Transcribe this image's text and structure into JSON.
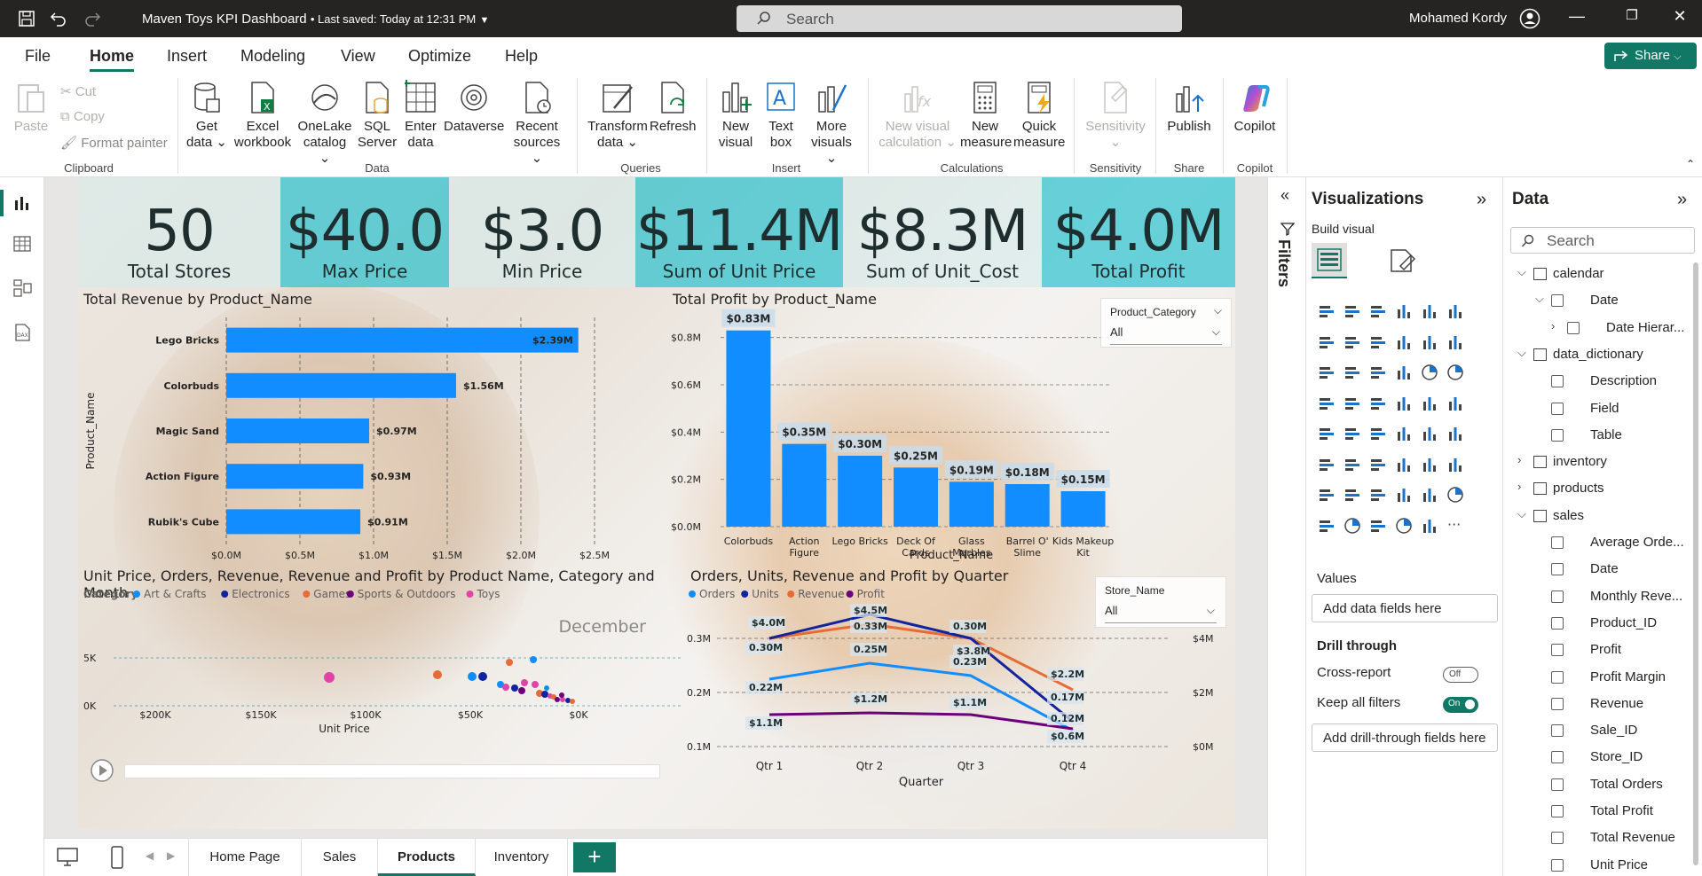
{
  "titlebar": {
    "title": "Maven Toys KPI Dashboard",
    "saved": "• Last saved: Today at 12:31 PM",
    "search_placeholder": "Search",
    "user": "Mohamed Kordy"
  },
  "menu": [
    "File",
    "Home",
    "Insert",
    "Modeling",
    "View",
    "Optimize",
    "Help"
  ],
  "share_label": "Share",
  "ribbon": {
    "clipboard": {
      "paste": "Paste",
      "cut": "Cut",
      "copy": "Copy",
      "format_painter": "Format painter",
      "group": "Clipboard"
    },
    "data": [
      {
        "l1": "Get",
        "l2": "data ⌄"
      },
      {
        "l1": "Excel",
        "l2": "workbook"
      },
      {
        "l1": "OneLake",
        "l2": "catalog ⌄"
      },
      {
        "l1": "SQL",
        "l2": "Server"
      },
      {
        "l1": "Enter",
        "l2": "data"
      },
      {
        "l1": "Dataverse",
        "l2": ""
      },
      {
        "l1": "Recent",
        "l2": "sources ⌄"
      }
    ],
    "data_group": "Data",
    "queries": [
      {
        "l1": "Transform",
        "l2": "data ⌄"
      },
      {
        "l1": "Refresh",
        "l2": ""
      }
    ],
    "queries_group": "Queries",
    "insert": [
      {
        "l1": "New",
        "l2": "visual"
      },
      {
        "l1": "Text",
        "l2": "box"
      },
      {
        "l1": "More",
        "l2": "visuals ⌄"
      }
    ],
    "insert_group": "Insert",
    "calculations": [
      {
        "l1": "New visual",
        "l2": "calculation ⌄"
      },
      {
        "l1": "New",
        "l2": "measure"
      },
      {
        "l1": "Quick",
        "l2": "measure"
      }
    ],
    "calculations_group": "Calculations",
    "sensitivity": {
      "l1": "Sensitivity",
      "l2": "⌄",
      "group": "Sensitivity"
    },
    "share": {
      "l1": "Publish",
      "group": "Share"
    },
    "copilot": {
      "l1": "Copilot",
      "group": "Copilot"
    }
  },
  "kpis": [
    {
      "value": "50",
      "label": "Total Stores"
    },
    {
      "value": "$40.0",
      "label": "Max Price"
    },
    {
      "value": "$3.0",
      "label": "Min Price"
    },
    {
      "value": "$11.4M",
      "label": "Sum of Unit Price"
    },
    {
      "value": "$8.3M",
      "label": "Sum of Unit_Cost"
    },
    {
      "value": "$4.0M",
      "label": "Total Profit"
    }
  ],
  "revenue_chart": {
    "title": "Total Revenue by Product_Name",
    "ylabel": "Product_Name",
    "categories": [
      "Lego Bricks",
      "Colorbuds",
      "Magic Sand",
      "Action Figure",
      "Rubik's Cube"
    ],
    "values": [
      2.39,
      1.56,
      0.97,
      0.93,
      0.91
    ],
    "labels": [
      "$2.39M",
      "$1.56M",
      "$0.97M",
      "$0.93M",
      "$0.91M"
    ],
    "xticks": [
      "$0.0M",
      "$0.5M",
      "$1.0M",
      "$1.5M",
      "$2.0M",
      "$2.5M"
    ],
    "xmax": 2.5
  },
  "profit_chart": {
    "title": "Total Profit by Product_Name",
    "xlabel": "Product_Name",
    "categories": [
      [
        "Colorbuds"
      ],
      [
        "Action",
        "Figure"
      ],
      [
        "Lego Bricks"
      ],
      [
        "Deck Of",
        "Cards"
      ],
      [
        "Glass",
        "Marbles"
      ],
      [
        "Barrel O'",
        "Slime"
      ],
      [
        "Kids Makeup",
        "Kit"
      ]
    ],
    "values": [
      0.83,
      0.35,
      0.3,
      0.25,
      0.19,
      0.18,
      0.15
    ],
    "labels": [
      "$0.83M",
      "$0.35M",
      "$0.30M",
      "$0.25M",
      "$0.19M",
      "$0.18M",
      "$0.15M"
    ],
    "yticks": [
      "$0.0M",
      "$0.2M",
      "$0.4M",
      "$0.6M",
      "$0.8M"
    ],
    "ymax": 0.9,
    "slicer": {
      "header": "Product_Category",
      "value": "All"
    }
  },
  "scatter_chart": {
    "title": "Unit Price, Orders, Revenue, Revenue and Profit by Product Name, Category and Month",
    "legend_title": "Category",
    "legend": [
      {
        "name": "Art & Crafts",
        "color": "#118dff"
      },
      {
        "name": "Electronics",
        "color": "#12239e"
      },
      {
        "name": "Games",
        "color": "#e66c37"
      },
      {
        "name": "Sports & Outdoors",
        "color": "#6b007b"
      },
      {
        "name": "Toys",
        "color": "#e044a7"
      }
    ],
    "play_label": "December",
    "xlabel": "Unit Price",
    "xticks": [
      "$200K",
      "$150K",
      "$100K",
      "$50K",
      "$0K"
    ],
    "yticks": [
      "0K",
      "5K"
    ]
  },
  "quarter_chart": {
    "title": "Orders, Units, Revenue and Profit by Quarter",
    "legend": [
      {
        "name": "Orders",
        "color": "#118dff"
      },
      {
        "name": "Units",
        "color": "#12239e"
      },
      {
        "name": "Revenue",
        "color": "#e66c37"
      },
      {
        "name": "Profit",
        "color": "#6b007b"
      }
    ],
    "xlabel": "Quarter",
    "categories": [
      "Qtr 1",
      "Qtr 2",
      "Qtr 3",
      "Qtr 4"
    ],
    "left_ticks": [
      "0.1M",
      "0.2M",
      "0.3M"
    ],
    "right_ticks": [
      "$0M",
      "$2M",
      "$4M"
    ],
    "labels": {
      "revenue": [
        "$4.0M",
        "$4.5M",
        "$3.8M",
        "$2.2M"
      ],
      "units": [
        "0.30M",
        "0.33M",
        "0.30M",
        "0.17M"
      ],
      "orders": [
        "0.22M",
        "0.25M",
        "0.23M",
        "0.12M"
      ],
      "profit": [
        "$1.1M",
        "$1.2M",
        "$1.1M",
        "$0.6M"
      ]
    },
    "slicer": {
      "header": "Store_Name",
      "value": "All"
    }
  },
  "tabs": [
    "Home Page",
    "Sales",
    "Products",
    "Inventory"
  ],
  "filters_label": "Filters",
  "viz_pane": {
    "title": "Visualizations",
    "build_visual": "Build visual",
    "values_label": "Values",
    "values_well": "Add data fields here",
    "drill_through": "Drill through",
    "cross_report": "Cross-report",
    "cross_report_state": "Off",
    "keep_filters": "Keep all filters",
    "keep_filters_state": "On",
    "drill_well": "Add drill-through fields here"
  },
  "data_pane": {
    "title": "Data",
    "search_placeholder": "Search",
    "items": [
      {
        "label": "calendar",
        "kind": "table",
        "level": 0,
        "chev": "⌵"
      },
      {
        "label": "Date",
        "kind": "field",
        "level": 1,
        "chev": "⌵",
        "checkbox": true
      },
      {
        "label": "Date Hierar...",
        "kind": "field",
        "level": 2,
        "chev": "›",
        "checkbox": true
      },
      {
        "label": "data_dictionary",
        "kind": "table",
        "level": 0,
        "chev": "⌵"
      },
      {
        "label": "Description",
        "kind": "field",
        "level": 1,
        "checkbox": true
      },
      {
        "label": "Field",
        "kind": "field",
        "level": 1,
        "checkbox": true
      },
      {
        "label": "Table",
        "kind": "field",
        "level": 1,
        "checkbox": true
      },
      {
        "label": "inventory",
        "kind": "table",
        "level": 0,
        "chev": "›"
      },
      {
        "label": "products",
        "kind": "table",
        "level": 0,
        "chev": "›"
      },
      {
        "label": "sales",
        "kind": "table",
        "level": 0,
        "chev": "⌵"
      },
      {
        "label": "Average Orde...",
        "kind": "field",
        "level": 1,
        "checkbox": true
      },
      {
        "label": "Date",
        "kind": "field",
        "level": 1,
        "checkbox": true
      },
      {
        "label": "Monthly Reve...",
        "kind": "field",
        "level": 1,
        "checkbox": true
      },
      {
        "label": "Product_ID",
        "kind": "field",
        "level": 1,
        "checkbox": true
      },
      {
        "label": "Profit",
        "kind": "field",
        "level": 1,
        "checkbox": true
      },
      {
        "label": "Profit Margin",
        "kind": "field",
        "level": 1,
        "checkbox": true
      },
      {
        "label": "Revenue",
        "kind": "field",
        "level": 1,
        "checkbox": true
      },
      {
        "label": "Sale_ID",
        "kind": "field",
        "level": 1,
        "checkbox": true
      },
      {
        "label": "Store_ID",
        "kind": "field",
        "level": 1,
        "checkbox": true
      },
      {
        "label": "Total Orders",
        "kind": "field",
        "level": 1,
        "checkbox": true
      },
      {
        "label": "Total Profit",
        "kind": "field",
        "level": 1,
        "checkbox": true
      },
      {
        "label": "Total Revenue",
        "kind": "field",
        "level": 1,
        "checkbox": true
      },
      {
        "label": "Unit Price",
        "kind": "field",
        "level": 1,
        "checkbox": true
      }
    ]
  }
}
